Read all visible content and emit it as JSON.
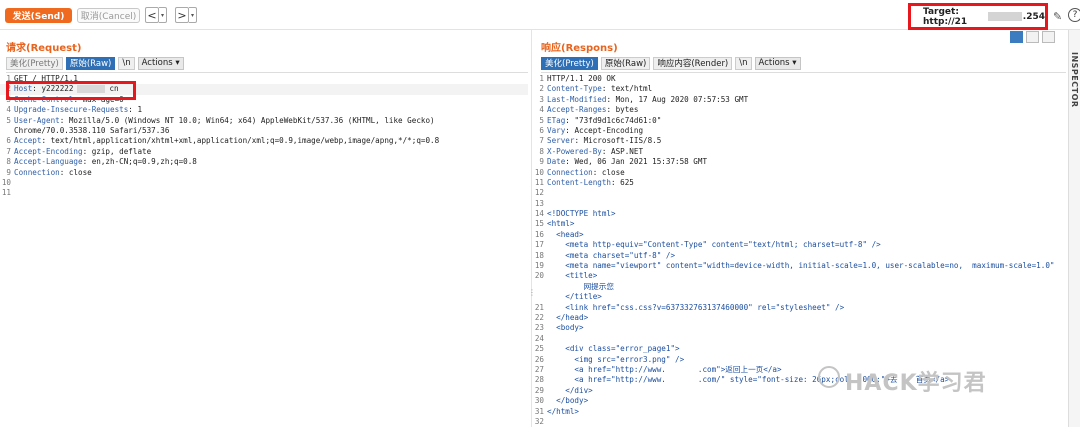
{
  "toolbar": {
    "send_label": "发送(Send)",
    "cancel_label": "取消(Cancel)",
    "back_label": "<",
    "forward_label": ">",
    "dropdown_glyph": "▾",
    "target_prefix": "Target: http://21",
    "target_suffix": ".254",
    "edit_icon": "✎",
    "help_icon": "?"
  },
  "inspector": {
    "label": "INSPECTOR"
  },
  "request": {
    "title": "请求(Request)",
    "tabs": [
      "美化(Pretty)",
      "原始(Raw)",
      "\\n",
      "Actions ▾"
    ],
    "lines": [
      {
        "n": "1",
        "k": "",
        "v": "GET / HTTP/1.1"
      },
      {
        "n": "2",
        "k": "Host",
        "v": ": y222222",
        "tail": "cn"
      },
      {
        "n": "3",
        "k": "Cache-Control",
        "v": ": max-age=0"
      },
      {
        "n": "4",
        "k": "Upgrade-Insecure-Requests",
        "v": ": 1"
      },
      {
        "n": "5",
        "k": "User-Agent",
        "v": ": Mozilla/5.0 (Windows NT 10.0; Win64; x64) AppleWebKit/537.36 (KHTML, like Gecko)"
      },
      {
        "n": "",
        "k": "",
        "v": "Chrome/70.0.3538.110 Safari/537.36"
      },
      {
        "n": "6",
        "k": "Accept",
        "v": ": text/html,application/xhtml+xml,application/xml;q=0.9,image/webp,image/apng,*/*;q=0.8"
      },
      {
        "n": "7",
        "k": "Accept-Encoding",
        "v": ": gzip, deflate"
      },
      {
        "n": "8",
        "k": "Accept-Language",
        "v": ": en,zh-CN;q=0.9,zh;q=0.8"
      },
      {
        "n": "9",
        "k": "Connection",
        "v": ": close"
      },
      {
        "n": "10",
        "k": "",
        "v": ""
      },
      {
        "n": "11",
        "k": "",
        "v": ""
      }
    ]
  },
  "response": {
    "title": "响应(Respons)",
    "tabs": [
      "美化(Pretty)",
      "原始(Raw)",
      "响应内容(Render)",
      "\\n",
      "Actions ▾"
    ],
    "headers": [
      {
        "n": "1",
        "k": "",
        "v": "HTTP/1.1 200 OK"
      },
      {
        "n": "2",
        "k": "Content-Type",
        "v": ": text/html"
      },
      {
        "n": "3",
        "k": "Last-Modified",
        "v": ": Mon, 17 Aug 2020 07:57:53 GMT"
      },
      {
        "n": "4",
        "k": "Accept-Ranges",
        "v": ": bytes"
      },
      {
        "n": "5",
        "k": "ETag",
        "v": ": \"73fd9d1c6c74d61:0\""
      },
      {
        "n": "6",
        "k": "Vary",
        "v": ": Accept-Encoding"
      },
      {
        "n": "7",
        "k": "Server",
        "v": ": Microsoft-IIS/8.5"
      },
      {
        "n": "8",
        "k": "X-Powered-By",
        "v": ": ASP.NET"
      },
      {
        "n": "9",
        "k": "Date",
        "v": ": Wed, 06 Jan 2021 15:37:58 GMT"
      },
      {
        "n": "10",
        "k": "Connection",
        "v": ": close"
      },
      {
        "n": "11",
        "k": "Content-Length",
        "v": ": 625"
      },
      {
        "n": "12",
        "k": "",
        "v": ""
      },
      {
        "n": "13",
        "k": "",
        "v": ""
      }
    ],
    "body": [
      {
        "n": "14",
        "t": "<!DOCTYPE html>"
      },
      {
        "n": "15",
        "t": "<html>"
      },
      {
        "n": "16",
        "t": "  <head>"
      },
      {
        "n": "17",
        "t": "    <meta http-equiv=\"Content-Type\" content=\"text/html; charset=utf-8\" />"
      },
      {
        "n": "18",
        "t": "    <meta charset=\"utf-8\" />"
      },
      {
        "n": "19",
        "t": "    <meta name=\"viewport\" content=\"width=device-width, initial-scale=1.0, user-scalable=no,  maximum-scale=1.0\""
      },
      {
        "n": "20",
        "t": "    <title>"
      },
      {
        "n": "",
        "t": "        网提示您"
      },
      {
        "n": "",
        "t": "    </title>"
      },
      {
        "n": "21",
        "t": "    <link href=\"css.css?v=637332763137460000\" rel=\"stylesheet\" />"
      },
      {
        "n": "22",
        "t": "  </head>"
      },
      {
        "n": "23",
        "t": "  <body>"
      },
      {
        "n": "24",
        "t": ""
      },
      {
        "n": "25",
        "t": "    <div class=\"error_page1\">"
      },
      {
        "n": "26",
        "t": "      <img src=\"error3.png\" />"
      },
      {
        "n": "27",
        "t": "      <a href=\"http://www.       .com\">返回上一页</a>"
      },
      {
        "n": "28",
        "t": "      <a href=\"http://www.       .com/\" style=\"font-size: 26px;col   000;\">去    首页</a>"
      },
      {
        "n": "29",
        "t": "    </div>"
      },
      {
        "n": "30",
        "t": "  </body>"
      },
      {
        "n": "31",
        "t": "</html>"
      },
      {
        "n": "32",
        "t": ""
      }
    ]
  },
  "watermark": {
    "text": "HACK学习君"
  }
}
